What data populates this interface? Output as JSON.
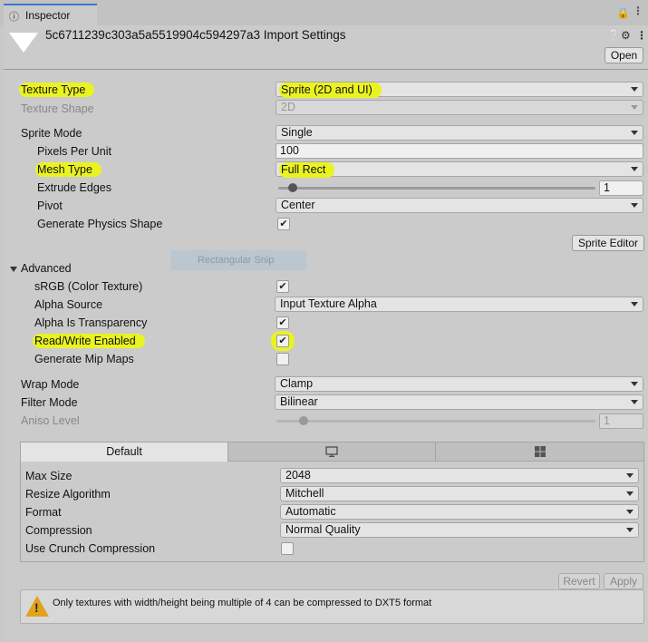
{
  "window": {
    "tab_label": "Inspector",
    "tab_icon": "info-icon",
    "lock_icon": "lock-icon",
    "menu_icon": "kebab-menu-icon"
  },
  "header": {
    "title": "5c6711239c303a5a5519904c594297a3 Import Settings",
    "help_icon": "help-icon",
    "settings_icon": "sliders-icon",
    "more_icon": "kebab-menu-icon",
    "open_label": "Open"
  },
  "general": {
    "texture_type": {
      "label": "Texture Type",
      "value": "Sprite (2D and UI)",
      "highlighted": true
    },
    "texture_shape": {
      "label": "Texture Shape",
      "value": "2D",
      "disabled": true
    }
  },
  "sprite": {
    "sprite_mode": {
      "label": "Sprite Mode",
      "value": "Single"
    },
    "pixels_per_unit": {
      "label": "Pixels Per Unit",
      "value": "100"
    },
    "mesh_type": {
      "label": "Mesh Type",
      "value": "Full Rect",
      "highlighted": true
    },
    "extrude_edges": {
      "label": "Extrude Edges",
      "value": "1",
      "slider_fraction": 0.03
    },
    "pivot": {
      "label": "Pivot",
      "value": "Center"
    },
    "physics_shape": {
      "label": "Generate Physics Shape",
      "checked": true
    },
    "editor_button": "Sprite Editor"
  },
  "ghost_overlay": "Rectangular Snip",
  "advanced": {
    "label": "Advanced",
    "srgb": {
      "label": "sRGB (Color Texture)",
      "checked": true
    },
    "alpha_source": {
      "label": "Alpha Source",
      "value": "Input Texture Alpha"
    },
    "alpha_transparency": {
      "label": "Alpha Is Transparency",
      "checked": true
    },
    "read_write": {
      "label": "Read/Write Enabled",
      "checked": true,
      "highlighted": true
    },
    "mip_maps": {
      "label": "Generate Mip Maps",
      "checked": false
    }
  },
  "wrap": {
    "wrap_mode": {
      "label": "Wrap Mode",
      "value": "Clamp"
    },
    "filter_mode": {
      "label": "Filter Mode",
      "value": "Bilinear"
    },
    "aniso_level": {
      "label": "Aniso Level",
      "value": "1",
      "disabled": true,
      "slider_fraction": 0.07
    }
  },
  "platform": {
    "tabs": [
      {
        "label": "Default",
        "icon": null,
        "active": true
      },
      {
        "label": "",
        "icon": "monitor-icon",
        "active": false
      },
      {
        "label": "",
        "icon": "windows-logo-icon",
        "active": false
      }
    ],
    "max_size": {
      "label": "Max Size",
      "value": "2048"
    },
    "resize_algorithm": {
      "label": "Resize Algorithm",
      "value": "Mitchell"
    },
    "format": {
      "label": "Format",
      "value": "Automatic"
    },
    "compression": {
      "label": "Compression",
      "value": "Normal Quality"
    },
    "crunch": {
      "label": "Use Crunch Compression",
      "checked": false
    }
  },
  "footer": {
    "revert_label": "Revert",
    "apply_label": "Apply"
  },
  "warning": {
    "icon": "warning-icon",
    "text": "Only textures with width/height being multiple of 4 can be compressed to DXT5 format"
  },
  "colors": {
    "highlight": "#eaf322",
    "tab_accent": "#3a78d6",
    "warning": "#e2a21c"
  }
}
